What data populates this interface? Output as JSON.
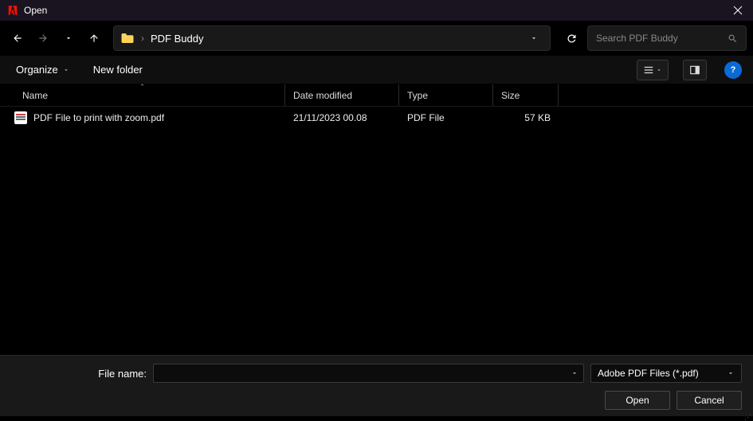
{
  "window": {
    "title": "Open"
  },
  "nav": {
    "breadcrumb": "PDF Buddy",
    "search_placeholder": "Search PDF Buddy"
  },
  "toolbar": {
    "organize_label": "Organize",
    "new_folder_label": "New folder"
  },
  "columns": {
    "name": "Name",
    "date": "Date modified",
    "type": "Type",
    "size": "Size"
  },
  "files": [
    {
      "name": "PDF File to print with zoom.pdf",
      "date": "21/11/2023 00.08",
      "type": "PDF File",
      "size": "57 KB"
    }
  ],
  "footer": {
    "filename_label": "File name:",
    "filename_value": "",
    "filter_label": "Adobe PDF Files (*.pdf)",
    "open_label": "Open",
    "cancel_label": "Cancel"
  }
}
